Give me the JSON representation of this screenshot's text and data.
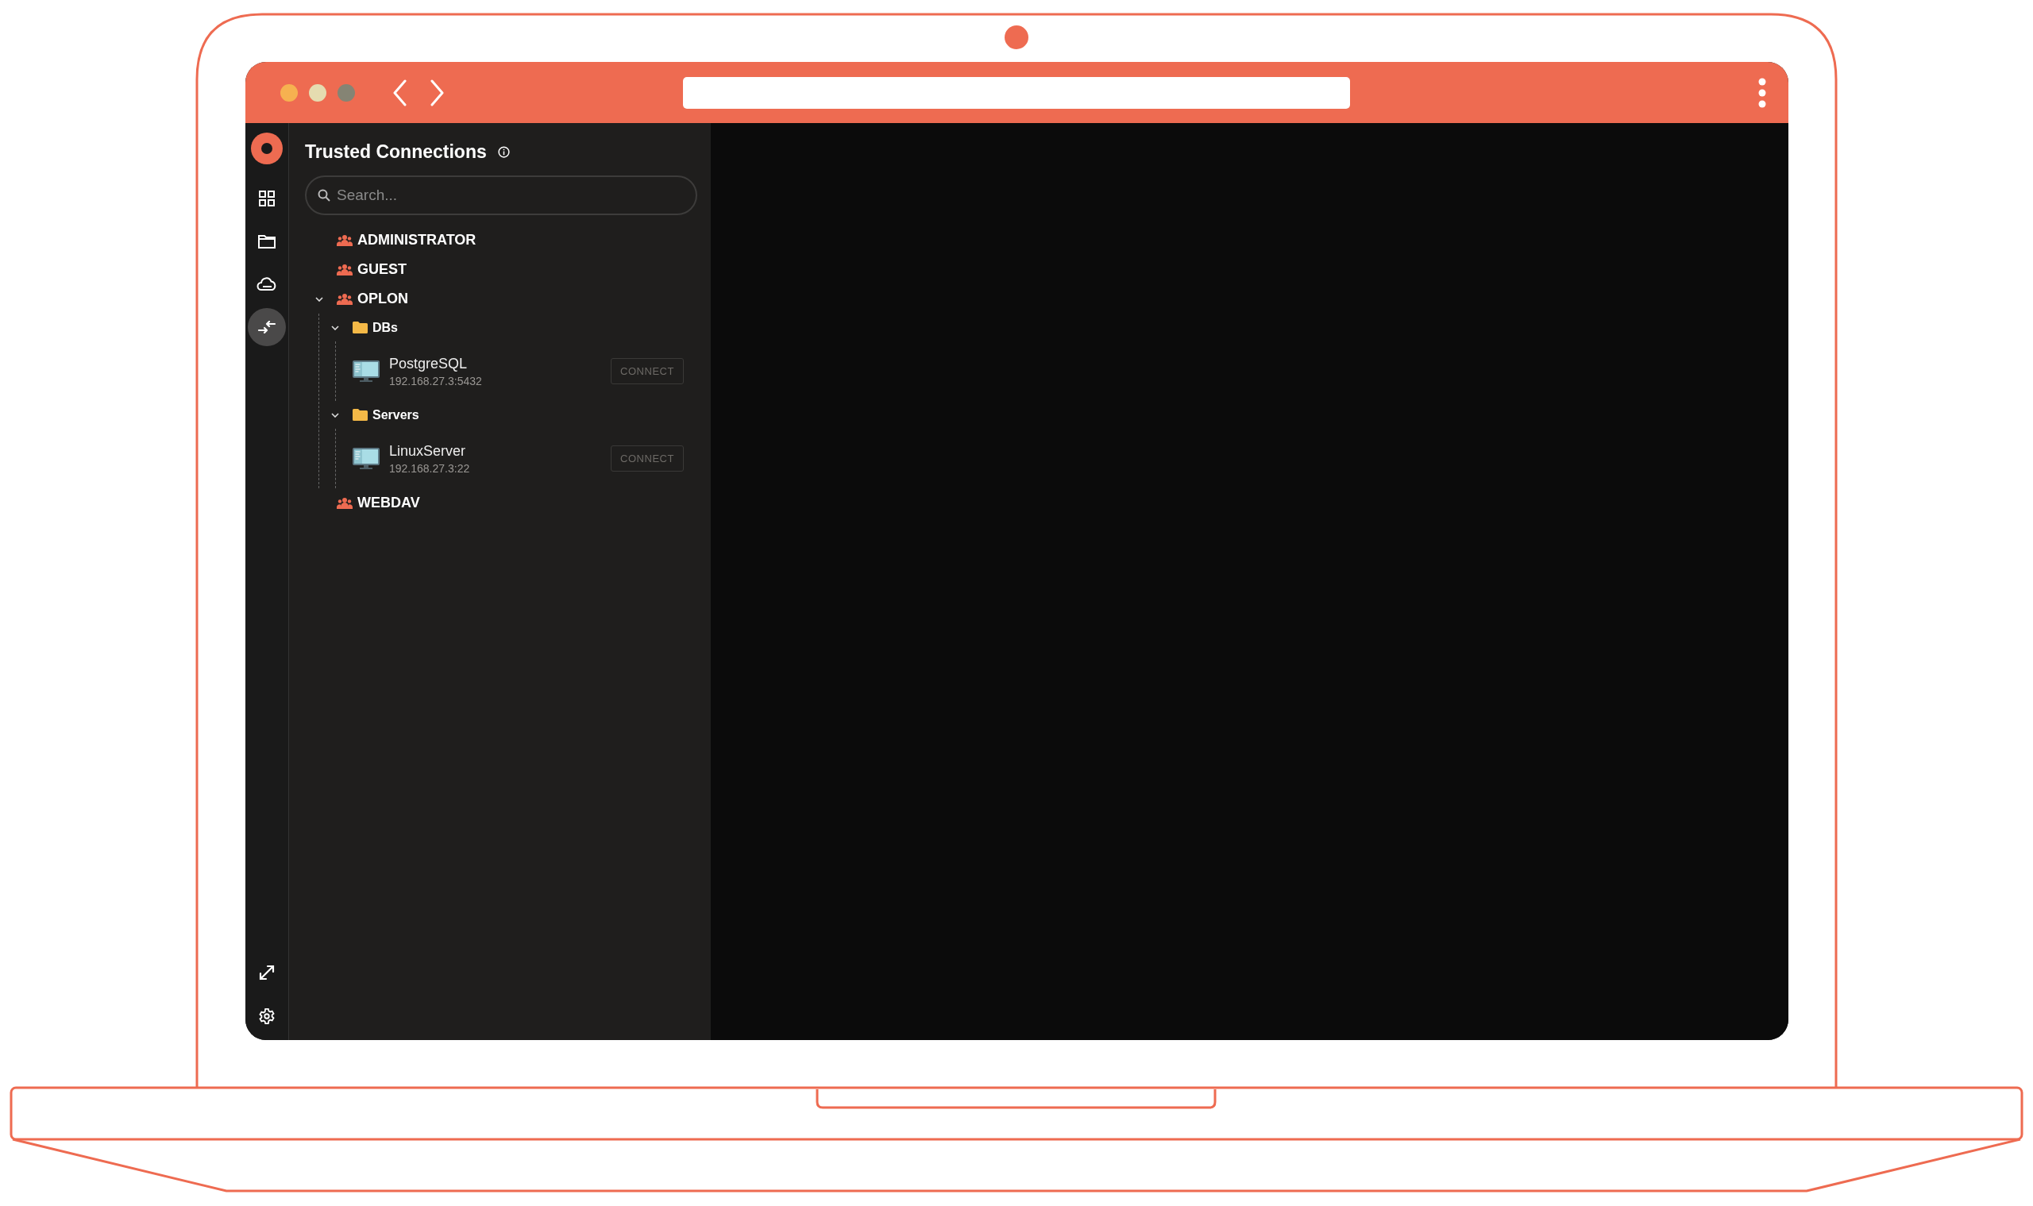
{
  "window": {
    "traffic_lights": [
      {
        "color": "#f6b150"
      },
      {
        "color": "#e5dcb0"
      },
      {
        "color": "#858474"
      }
    ]
  },
  "rail": {
    "top_items": [
      {
        "kind": "grid",
        "selected": false
      },
      {
        "kind": "folder",
        "selected": false
      },
      {
        "kind": "cloud",
        "selected": false
      },
      {
        "kind": "connections",
        "selected": true
      }
    ],
    "bottom_items": [
      {
        "kind": "expand",
        "selected": false
      },
      {
        "kind": "settings",
        "selected": false
      }
    ]
  },
  "panel": {
    "title": "Trusted Connections",
    "search": {
      "placeholder": "Search..."
    },
    "tree": [
      {
        "kind": "group",
        "label": "ADMINISTRATOR",
        "expanded": false
      },
      {
        "kind": "group",
        "label": "GUEST",
        "expanded": false
      },
      {
        "kind": "group",
        "label": "OPLON",
        "expanded": true,
        "children": [
          {
            "kind": "folder",
            "label": "DBs",
            "expanded": true,
            "children": [
              {
                "kind": "connection",
                "name": "PostgreSQL",
                "address": "192.168.27.3:5432",
                "button": "CONNECT"
              }
            ]
          },
          {
            "kind": "folder",
            "label": "Servers",
            "expanded": true,
            "children": [
              {
                "kind": "connection",
                "name": "LinuxServer",
                "address": "192.168.27.3:22",
                "button": "CONNECT"
              }
            ]
          }
        ]
      },
      {
        "kind": "group",
        "label": "WEBDAV",
        "expanded": false
      }
    ]
  }
}
